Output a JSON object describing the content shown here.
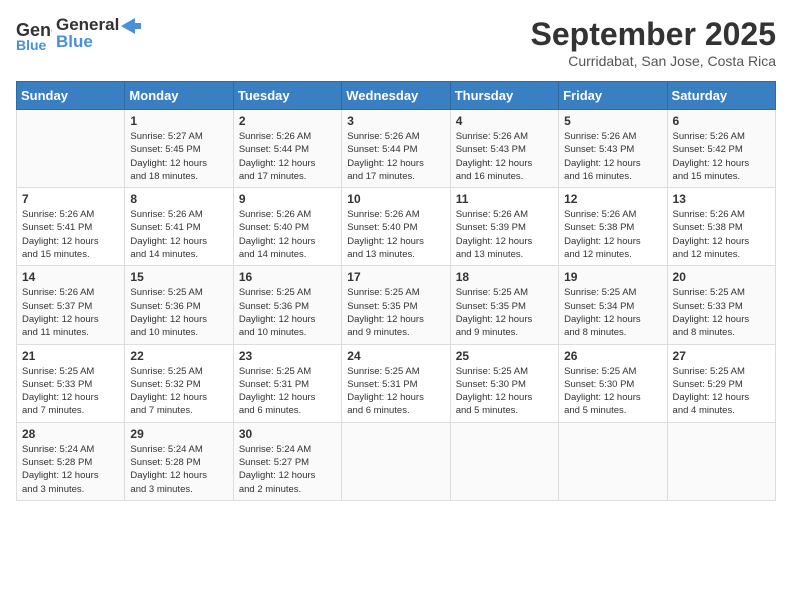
{
  "logo": {
    "general": "General",
    "blue": "Blue"
  },
  "title": "September 2025",
  "subtitle": "Curridabat, San Jose, Costa Rica",
  "days_of_week": [
    "Sunday",
    "Monday",
    "Tuesday",
    "Wednesday",
    "Thursday",
    "Friday",
    "Saturday"
  ],
  "weeks": [
    [
      {
        "day": "",
        "info": ""
      },
      {
        "day": "1",
        "info": "Sunrise: 5:27 AM\nSunset: 5:45 PM\nDaylight: 12 hours\nand 18 minutes."
      },
      {
        "day": "2",
        "info": "Sunrise: 5:26 AM\nSunset: 5:44 PM\nDaylight: 12 hours\nand 17 minutes."
      },
      {
        "day": "3",
        "info": "Sunrise: 5:26 AM\nSunset: 5:44 PM\nDaylight: 12 hours\nand 17 minutes."
      },
      {
        "day": "4",
        "info": "Sunrise: 5:26 AM\nSunset: 5:43 PM\nDaylight: 12 hours\nand 16 minutes."
      },
      {
        "day": "5",
        "info": "Sunrise: 5:26 AM\nSunset: 5:43 PM\nDaylight: 12 hours\nand 16 minutes."
      },
      {
        "day": "6",
        "info": "Sunrise: 5:26 AM\nSunset: 5:42 PM\nDaylight: 12 hours\nand 15 minutes."
      }
    ],
    [
      {
        "day": "7",
        "info": "Sunrise: 5:26 AM\nSunset: 5:41 PM\nDaylight: 12 hours\nand 15 minutes."
      },
      {
        "day": "8",
        "info": "Sunrise: 5:26 AM\nSunset: 5:41 PM\nDaylight: 12 hours\nand 14 minutes."
      },
      {
        "day": "9",
        "info": "Sunrise: 5:26 AM\nSunset: 5:40 PM\nDaylight: 12 hours\nand 14 minutes."
      },
      {
        "day": "10",
        "info": "Sunrise: 5:26 AM\nSunset: 5:40 PM\nDaylight: 12 hours\nand 13 minutes."
      },
      {
        "day": "11",
        "info": "Sunrise: 5:26 AM\nSunset: 5:39 PM\nDaylight: 12 hours\nand 13 minutes."
      },
      {
        "day": "12",
        "info": "Sunrise: 5:26 AM\nSunset: 5:38 PM\nDaylight: 12 hours\nand 12 minutes."
      },
      {
        "day": "13",
        "info": "Sunrise: 5:26 AM\nSunset: 5:38 PM\nDaylight: 12 hours\nand 12 minutes."
      }
    ],
    [
      {
        "day": "14",
        "info": "Sunrise: 5:26 AM\nSunset: 5:37 PM\nDaylight: 12 hours\nand 11 minutes."
      },
      {
        "day": "15",
        "info": "Sunrise: 5:25 AM\nSunset: 5:36 PM\nDaylight: 12 hours\nand 10 minutes."
      },
      {
        "day": "16",
        "info": "Sunrise: 5:25 AM\nSunset: 5:36 PM\nDaylight: 12 hours\nand 10 minutes."
      },
      {
        "day": "17",
        "info": "Sunrise: 5:25 AM\nSunset: 5:35 PM\nDaylight: 12 hours\nand 9 minutes."
      },
      {
        "day": "18",
        "info": "Sunrise: 5:25 AM\nSunset: 5:35 PM\nDaylight: 12 hours\nand 9 minutes."
      },
      {
        "day": "19",
        "info": "Sunrise: 5:25 AM\nSunset: 5:34 PM\nDaylight: 12 hours\nand 8 minutes."
      },
      {
        "day": "20",
        "info": "Sunrise: 5:25 AM\nSunset: 5:33 PM\nDaylight: 12 hours\nand 8 minutes."
      }
    ],
    [
      {
        "day": "21",
        "info": "Sunrise: 5:25 AM\nSunset: 5:33 PM\nDaylight: 12 hours\nand 7 minutes."
      },
      {
        "day": "22",
        "info": "Sunrise: 5:25 AM\nSunset: 5:32 PM\nDaylight: 12 hours\nand 7 minutes."
      },
      {
        "day": "23",
        "info": "Sunrise: 5:25 AM\nSunset: 5:31 PM\nDaylight: 12 hours\nand 6 minutes."
      },
      {
        "day": "24",
        "info": "Sunrise: 5:25 AM\nSunset: 5:31 PM\nDaylight: 12 hours\nand 6 minutes."
      },
      {
        "day": "25",
        "info": "Sunrise: 5:25 AM\nSunset: 5:30 PM\nDaylight: 12 hours\nand 5 minutes."
      },
      {
        "day": "26",
        "info": "Sunrise: 5:25 AM\nSunset: 5:30 PM\nDaylight: 12 hours\nand 5 minutes."
      },
      {
        "day": "27",
        "info": "Sunrise: 5:25 AM\nSunset: 5:29 PM\nDaylight: 12 hours\nand 4 minutes."
      }
    ],
    [
      {
        "day": "28",
        "info": "Sunrise: 5:24 AM\nSunset: 5:28 PM\nDaylight: 12 hours\nand 3 minutes."
      },
      {
        "day": "29",
        "info": "Sunrise: 5:24 AM\nSunset: 5:28 PM\nDaylight: 12 hours\nand 3 minutes."
      },
      {
        "day": "30",
        "info": "Sunrise: 5:24 AM\nSunset: 5:27 PM\nDaylight: 12 hours\nand 2 minutes."
      },
      {
        "day": "",
        "info": ""
      },
      {
        "day": "",
        "info": ""
      },
      {
        "day": "",
        "info": ""
      },
      {
        "day": "",
        "info": ""
      }
    ]
  ]
}
